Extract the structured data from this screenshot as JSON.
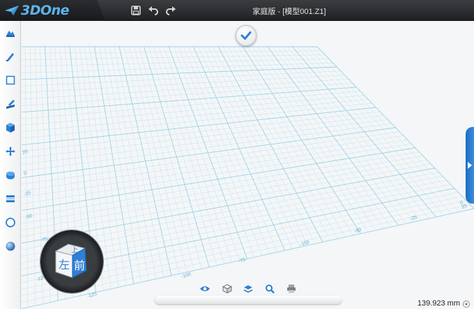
{
  "app": {
    "name": "3DOne",
    "window_title": "家庭版 - [模型001.Z1]"
  },
  "toolbar": {
    "icons": [
      "save-icon",
      "undo-icon",
      "redo-icon"
    ]
  },
  "left_toolbar": {
    "items": [
      "sketch-shape-icon",
      "pen-draw-icon",
      "rectangle-icon",
      "modify-edit-icon",
      "solid-cube-icon",
      "move-transform-icon",
      "combine-icon",
      "layers-icon",
      "circle-icon",
      "sphere-material-icon"
    ]
  },
  "viewport": {
    "grid_labels": [
      "-75",
      "-100",
      "-125",
      "-50",
      "-25",
      "0",
      "25",
      "-75",
      "-100",
      "-125",
      "-150",
      "-50",
      "-25",
      "0",
      "25"
    ],
    "view_cube": {
      "top_label": "上",
      "left_label": "左",
      "front_label": "前"
    }
  },
  "bottom_toolbar": {
    "icons": [
      "eye-view-icon",
      "cube-view-icon",
      "layer-stack-icon",
      "zoom-search-icon",
      "print-icon"
    ]
  },
  "status": {
    "distance": "139.923 mm"
  },
  "colors": {
    "grid_line": "#7fc6e3",
    "accent": "#2f7fd4",
    "titlebar": "#2a2d30"
  }
}
